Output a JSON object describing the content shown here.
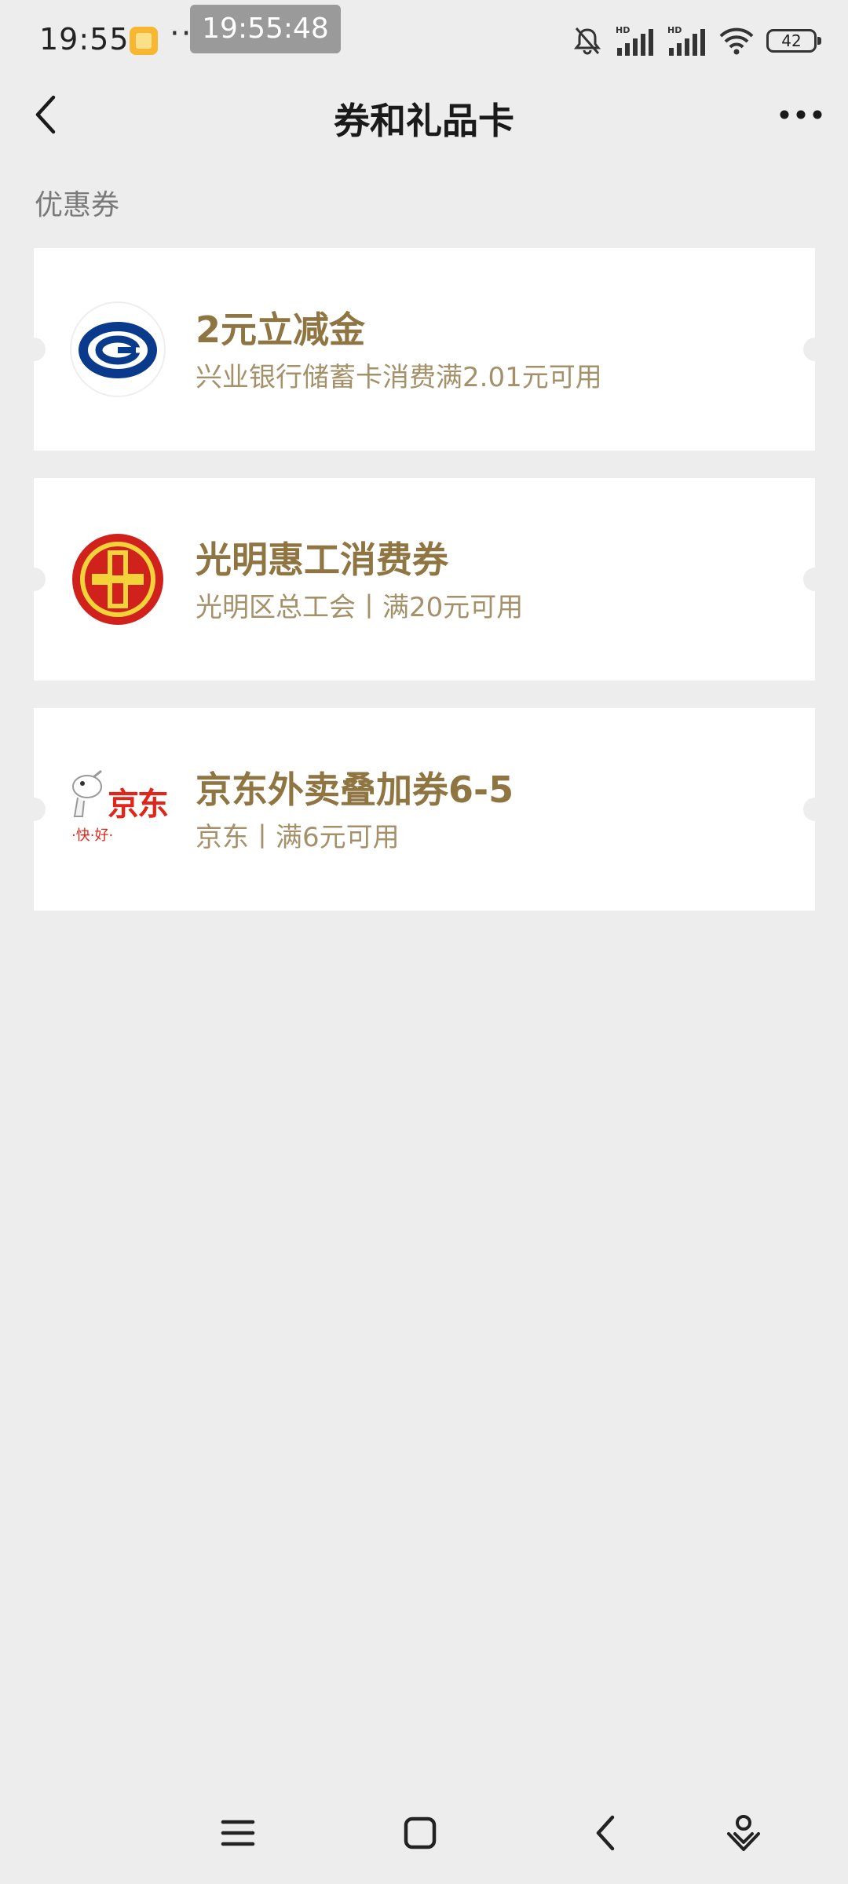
{
  "status_bar": {
    "time": "19:55",
    "dots": "··",
    "clock_overlay": "19:55:48",
    "battery": "42"
  },
  "nav": {
    "title": "券和礼品卡"
  },
  "section": {
    "label": "优惠券"
  },
  "coupons": [
    {
      "title": "2元立减金",
      "description": "兴业银行储蓄卡消费满2.01元可用",
      "logo": "cib-bank-logo"
    },
    {
      "title": "光明惠工消费券",
      "description": "光明区总工会丨满20元可用",
      "logo": "trade-union-logo"
    },
    {
      "title": "京东外卖叠加券6-5",
      "description": "京东丨满6元可用",
      "logo": "jd-logo",
      "logo_text": "京东",
      "logo_slogan": "·快·好·"
    }
  ],
  "colors": {
    "background": "#ededed",
    "card": "#ffffff",
    "coupon_title": "#8f7541",
    "coupon_desc": "#a4916a",
    "bank_blue": "#0a3a8c",
    "union_red": "#d0211c",
    "union_gold": "#f3d33a",
    "jd_red": "#e1251b"
  }
}
